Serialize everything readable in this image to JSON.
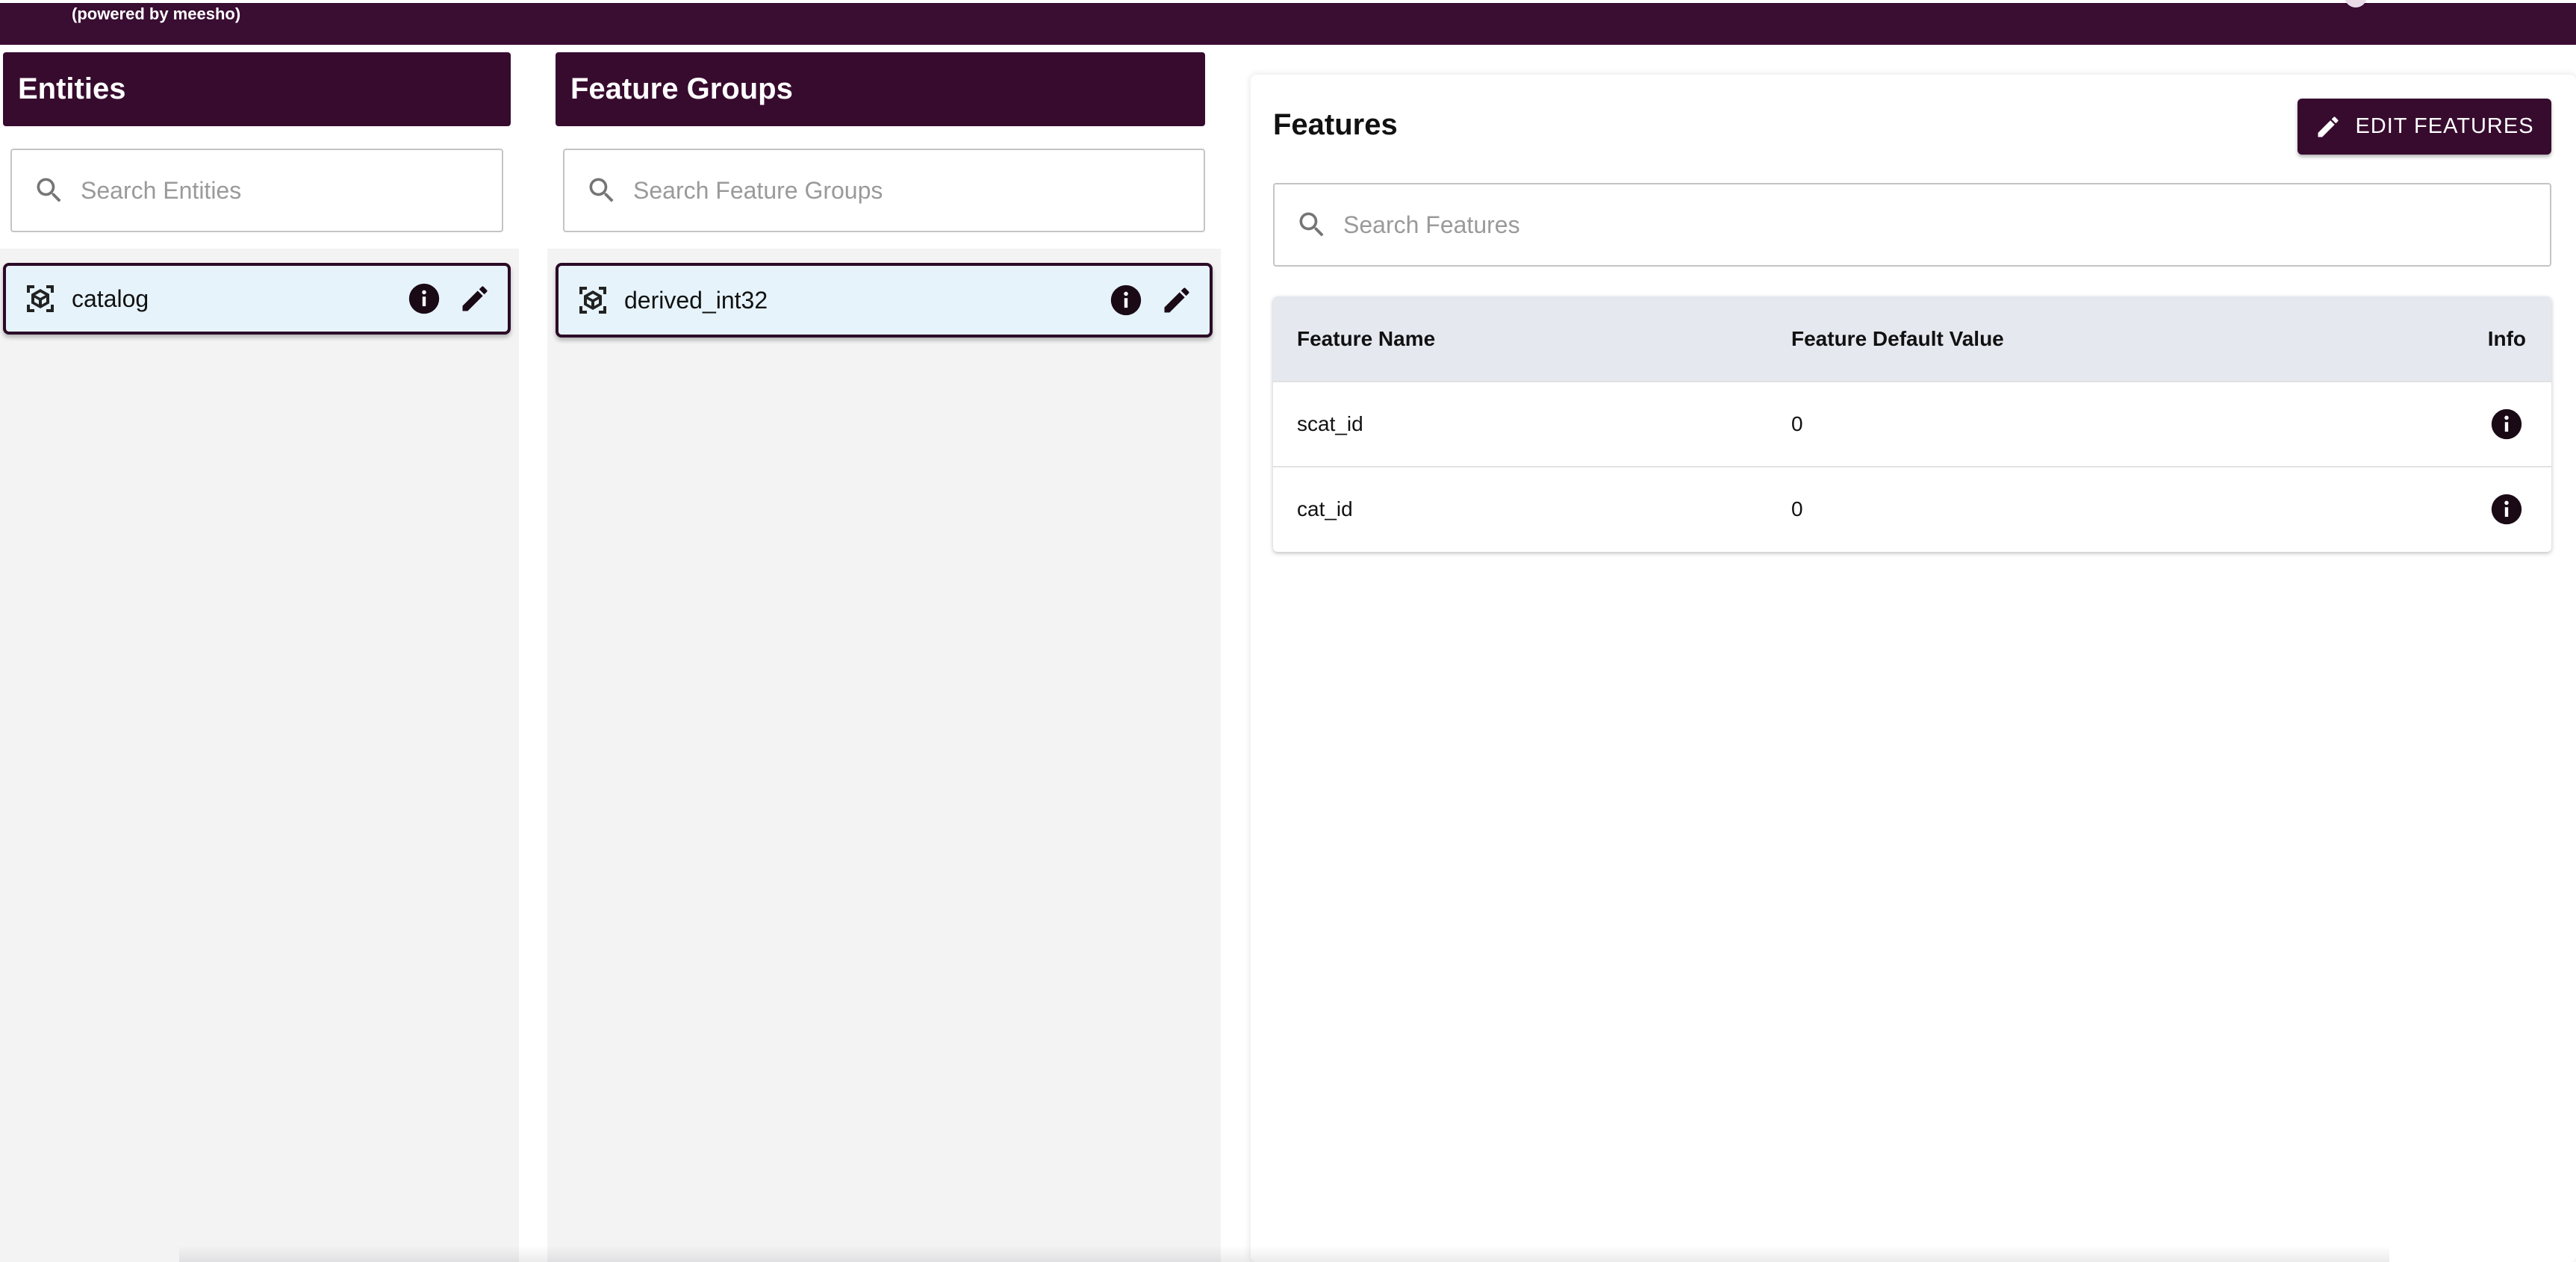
{
  "header": {
    "powered_by": "(powered by meesho)"
  },
  "entities": {
    "title": "Entities",
    "search_placeholder": "Search Entities",
    "items": [
      {
        "label": "catalog"
      }
    ]
  },
  "feature_groups": {
    "title": "Feature Groups",
    "search_placeholder": "Search Feature Groups",
    "items": [
      {
        "label": "derived_int32"
      }
    ]
  },
  "features": {
    "title": "Features",
    "edit_button_label": "EDIT FEATURES",
    "search_placeholder": "Search Features",
    "table": {
      "columns": [
        "Feature Name",
        "Feature Default Value",
        "Info"
      ],
      "rows": [
        {
          "name": "scat_id",
          "default_value": "0"
        },
        {
          "name": "cat_id",
          "default_value": "0"
        }
      ]
    }
  },
  "colors": {
    "brand_dark": "#370b2e",
    "selected_bg": "#e6f3fb",
    "column_bg": "#f3f3f4",
    "table_header_bg": "#e6e8ef"
  },
  "icons": {
    "search": "search-icon",
    "entity": "cube-scan-icon",
    "info": "info-icon",
    "edit": "pencil-icon"
  }
}
